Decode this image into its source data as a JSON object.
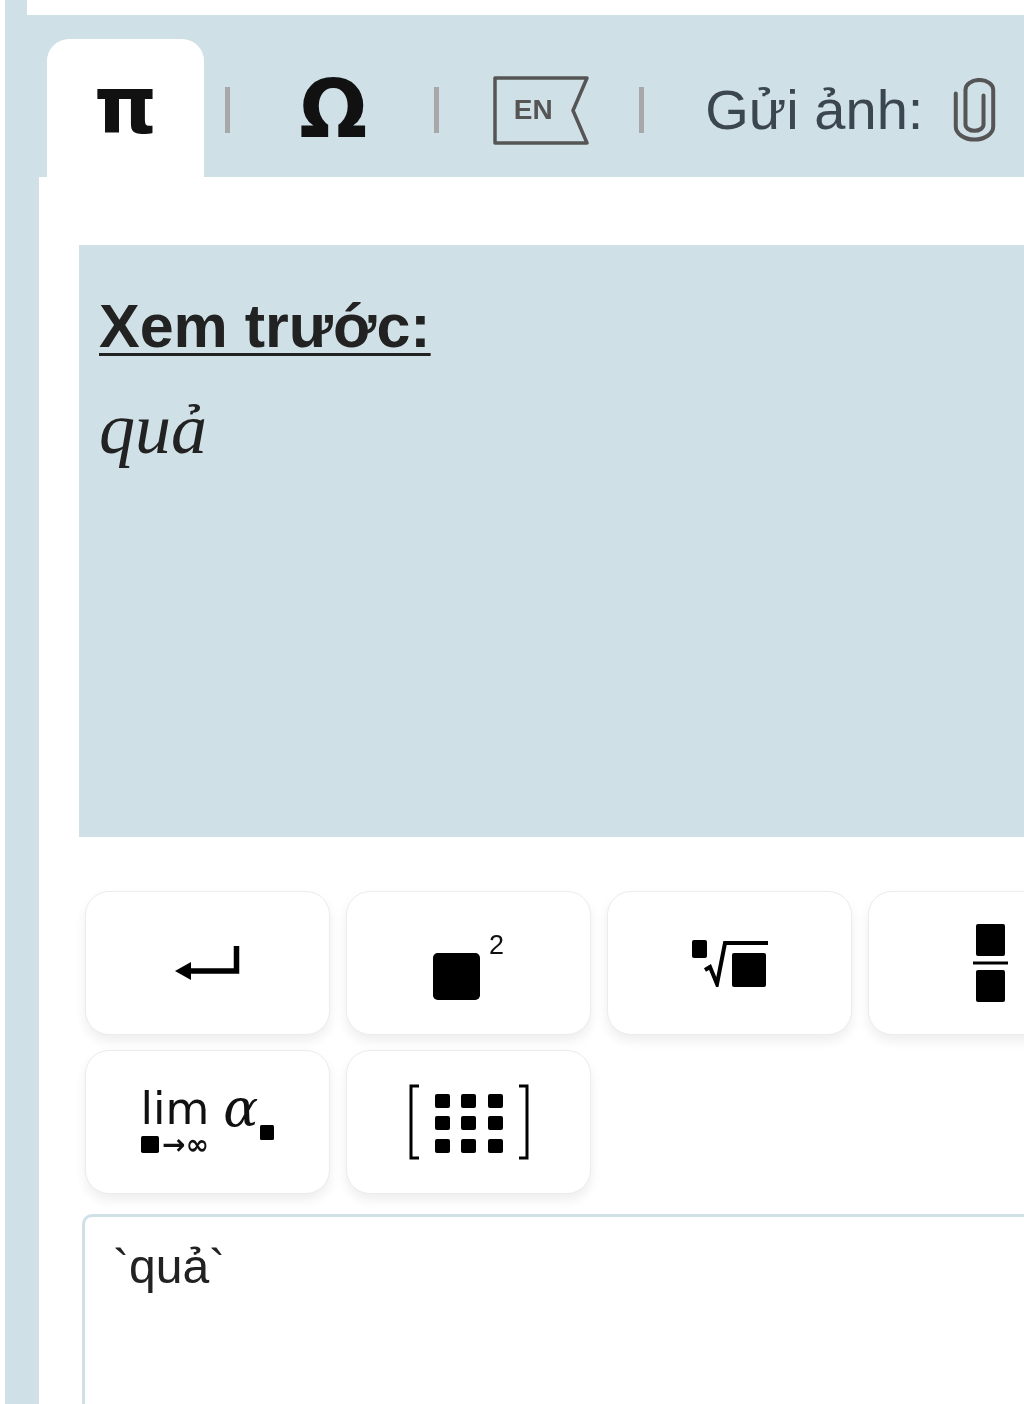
{
  "tabs": [
    {
      "kind": "symbol",
      "label": "π",
      "selected": true
    },
    {
      "kind": "symbol",
      "label": "Ω",
      "selected": false
    },
    {
      "kind": "flag",
      "label": "EN",
      "selected": false
    },
    {
      "kind": "upload",
      "label": "Gửi ảnh:",
      "selected": false
    }
  ],
  "preview": {
    "heading": "Xem trước:",
    "formula": "quả"
  },
  "keyboard": {
    "keys": [
      {
        "kind": "newline"
      },
      {
        "kind": "power",
        "exponent": "2"
      },
      {
        "kind": "root"
      },
      {
        "kind": "fraction"
      },
      {
        "kind": "limit",
        "operator": "lim",
        "approach": "→∞",
        "variable": "α"
      },
      {
        "kind": "matrix"
      }
    ]
  },
  "input": {
    "value": "`quả`"
  }
}
